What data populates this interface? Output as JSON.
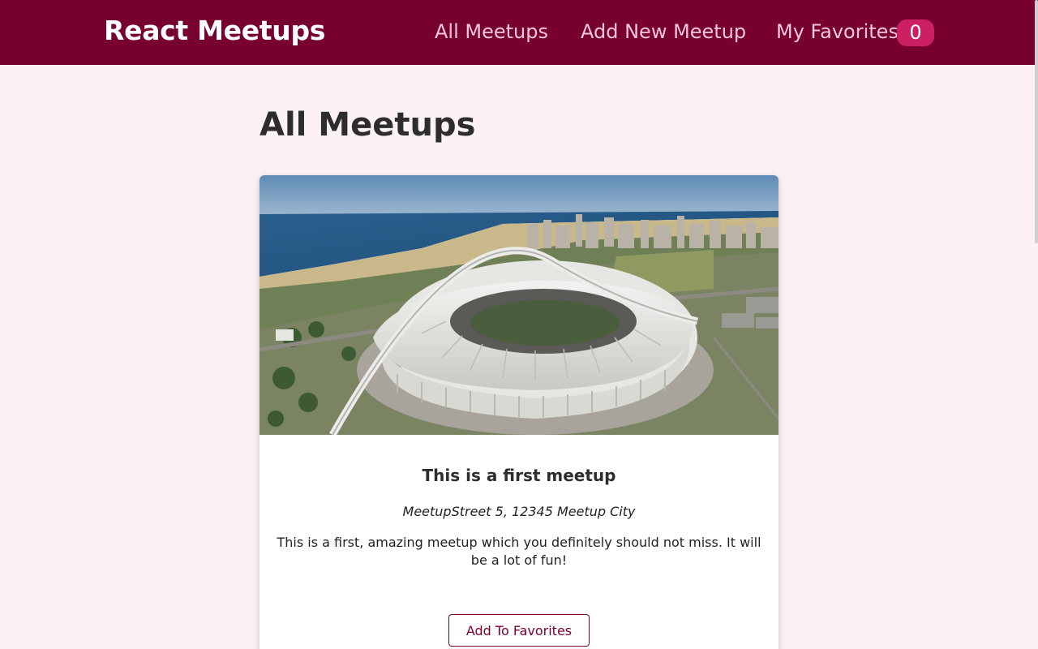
{
  "header": {
    "logo": "React Meetups",
    "nav": {
      "all_meetups": "All Meetups",
      "add_new": "Add New Meetup",
      "favorites": "My Favorites",
      "favorites_count": "0"
    }
  },
  "main": {
    "title": "All Meetups",
    "meetups": [
      {
        "title": "This is a first meetup",
        "address": "MeetupStreet 5, 12345 Meetup City",
        "description": "This is a first, amazing meetup which you definitely should not miss. It will be a lot of fun!",
        "button_label": "Add To Favorites"
      }
    ]
  },
  "colors": {
    "header_bg": "#77002e",
    "page_bg": "#fcf1f4",
    "badge_bg": "#cc2062",
    "accent": "#77002e"
  }
}
